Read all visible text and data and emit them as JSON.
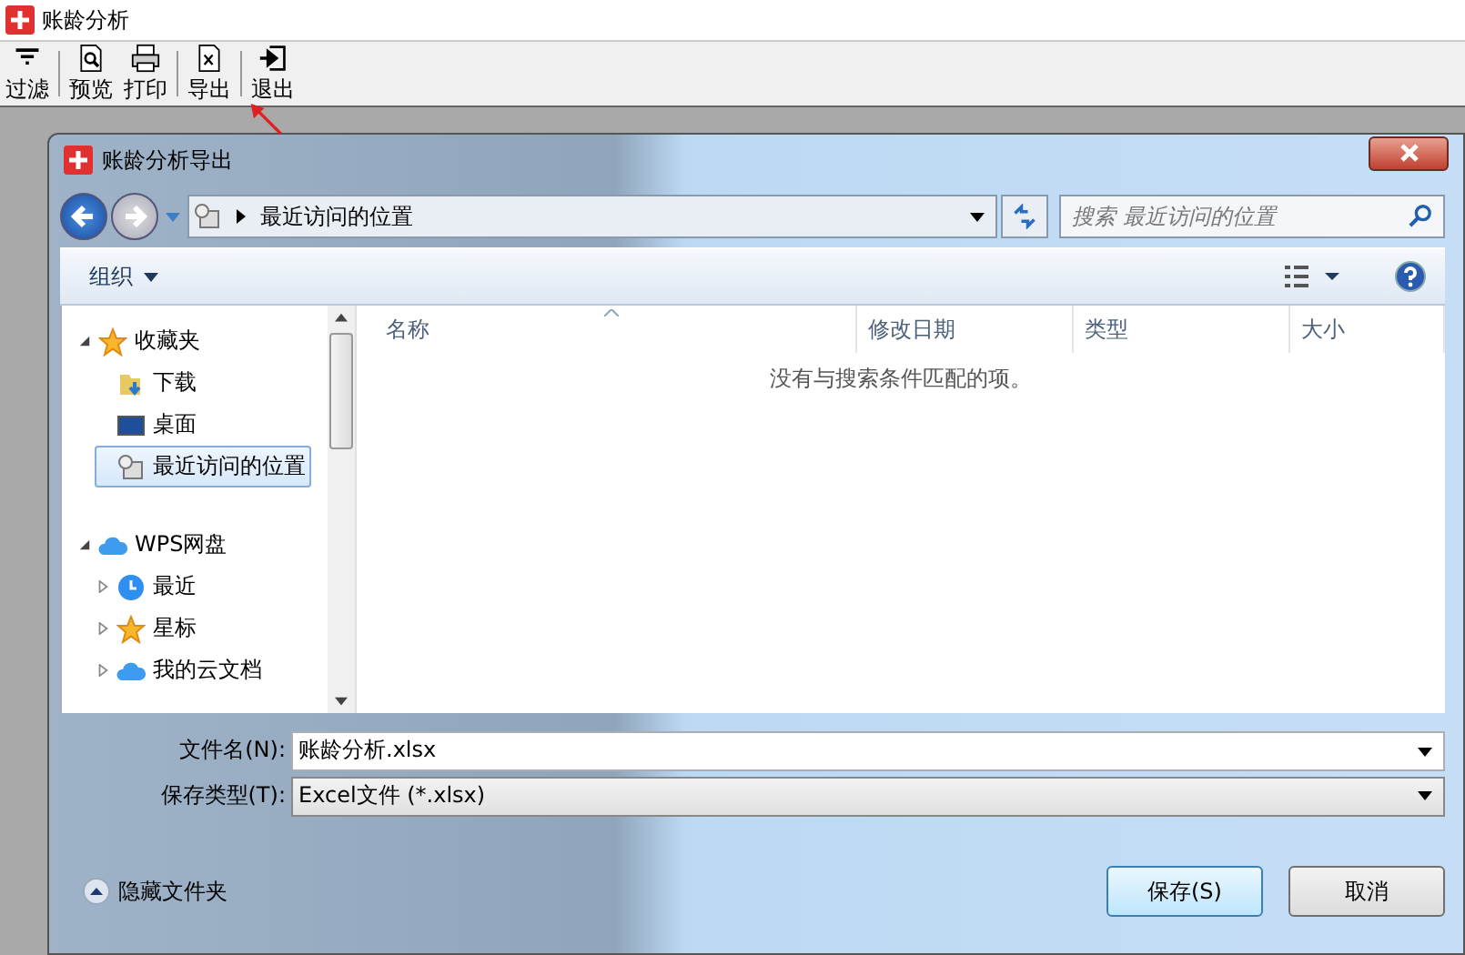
{
  "window": {
    "title": "账龄分析"
  },
  "toolbar": [
    {
      "label": "过滤"
    },
    {
      "label": "预览"
    },
    {
      "label": "打印"
    },
    {
      "label": "导出"
    },
    {
      "label": "退出"
    }
  ],
  "dialog": {
    "title": "账龄分析导出",
    "address": {
      "path": "最近访问的位置"
    },
    "search": {
      "placeholder": "搜索 最近访问的位置"
    },
    "organize": {
      "label": "组织"
    },
    "tree": [
      {
        "label": "收藏夹",
        "expanded": true,
        "selected": false,
        "children": [
          {
            "label": "下载",
            "selected": false
          },
          {
            "label": "桌面",
            "selected": false
          },
          {
            "label": "最近访问的位置",
            "selected": true
          }
        ]
      },
      {
        "label": "WPS网盘",
        "expanded": true,
        "selected": false,
        "children": [
          {
            "label": "最近",
            "expanded": false,
            "selected": false
          },
          {
            "label": "星标",
            "expanded": false,
            "selected": false
          },
          {
            "label": "我的云文档",
            "expanded": false,
            "selected": false
          }
        ]
      }
    ],
    "columns": [
      "名称",
      "修改日期",
      "类型",
      "大小"
    ],
    "empty_message": "没有与搜索条件匹配的项。",
    "file_name": {
      "label": "文件名(N):",
      "value": "账龄分析.xlsx"
    },
    "file_type": {
      "label": "保存类型(T):",
      "value": "Excel文件 (*.xlsx)"
    },
    "hide_folders": {
      "label": "隐藏文件夹"
    },
    "buttons": [
      {
        "label": "保存(S)",
        "default": true
      },
      {
        "label": "取消",
        "default": false
      }
    ]
  }
}
